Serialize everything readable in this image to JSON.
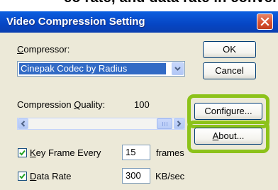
{
  "caption": "eo rate, and data rate in conver",
  "window": {
    "title": "Video Compression Setting"
  },
  "compressor": {
    "label_pre": "",
    "label_key": "C",
    "label_post": "ompressor:",
    "selected": "Cinepak Codec by Radius"
  },
  "quality": {
    "label_pre": "Compression ",
    "label_key": "Q",
    "label_post": "uality:",
    "value": "100",
    "slider_fraction": 1.0
  },
  "key_frame": {
    "checked": true,
    "label_pre": "",
    "label_key": "K",
    "label_post": "ey Frame Every",
    "value": "15",
    "unit": "frames"
  },
  "data_rate": {
    "checked": true,
    "label_pre": "",
    "label_key": "D",
    "label_post": "ata Rate",
    "value": "300",
    "unit": "KB/sec"
  },
  "buttons": {
    "ok": "OK",
    "cancel": "Cancel",
    "configure": "Configure...",
    "about_pre": "",
    "about_key": "A",
    "about_post": "bout..."
  },
  "colors": {
    "highlight": "#8cc21a",
    "titlebar": "#0a56d6",
    "selection": "#316ac5",
    "dialog_bg": "#ece9d8"
  }
}
